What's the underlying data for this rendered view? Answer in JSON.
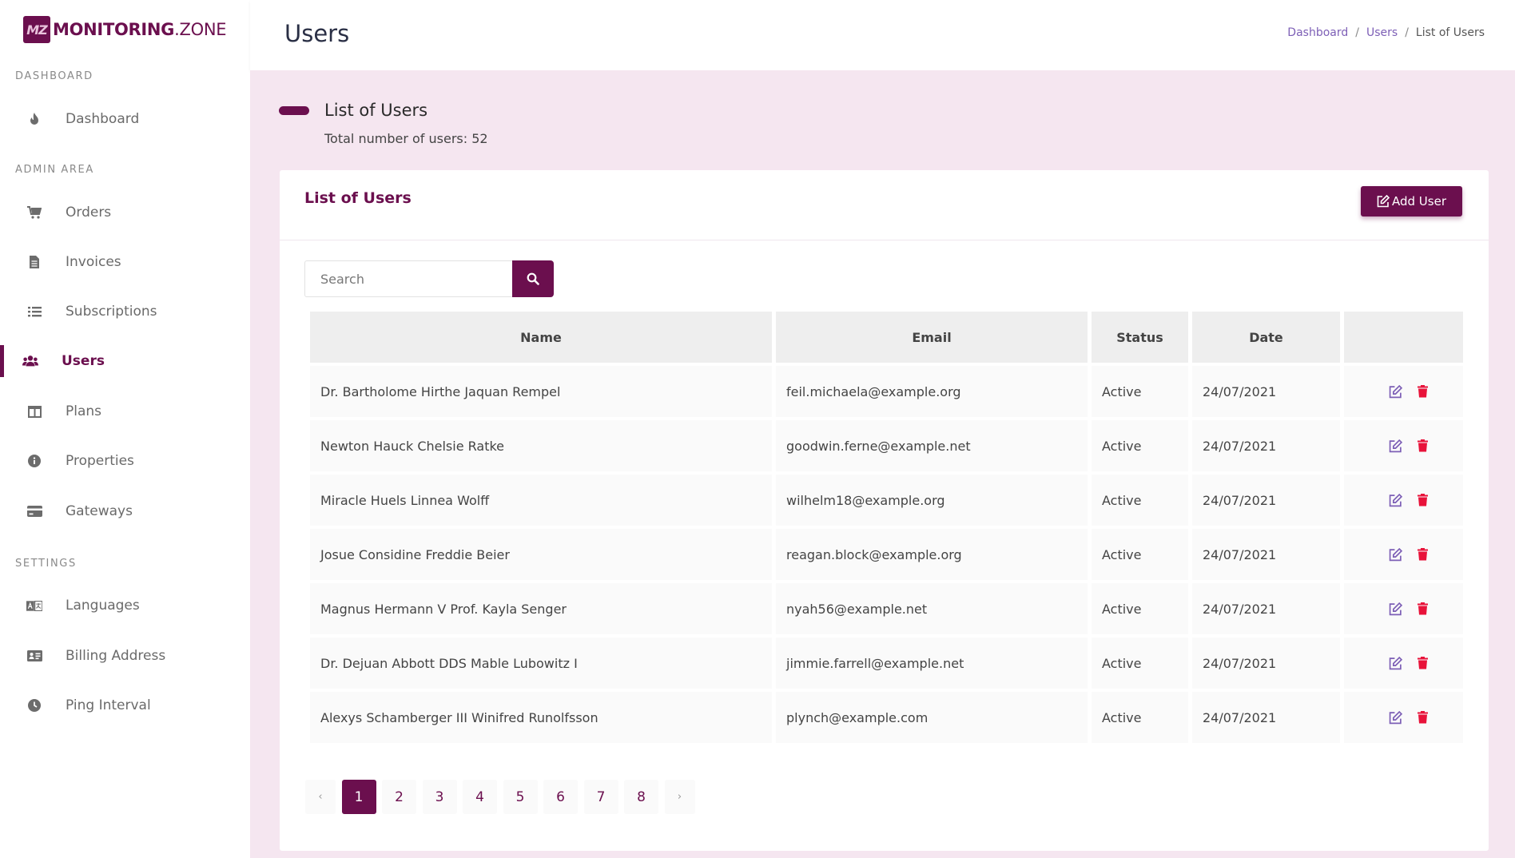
{
  "brand": {
    "badge": "MZ",
    "name_bold": "MONITORING",
    "name_light": ".ZONE"
  },
  "sidebar": {
    "sections": [
      {
        "label": "DASHBOARD"
      },
      {
        "label": "ADMIN AREA"
      },
      {
        "label": "SETTINGS"
      }
    ],
    "items": [
      {
        "label": "Dashboard",
        "icon": "fire-icon"
      },
      {
        "label": "Orders",
        "icon": "cart-icon"
      },
      {
        "label": "Invoices",
        "icon": "document-icon"
      },
      {
        "label": "Subscriptions",
        "icon": "list-icon"
      },
      {
        "label": "Users",
        "icon": "users-icon",
        "active": true
      },
      {
        "label": "Plans",
        "icon": "columns-icon"
      },
      {
        "label": "Properties",
        "icon": "info-icon"
      },
      {
        "label": "Gateways",
        "icon": "credit-card-icon"
      },
      {
        "label": "Languages",
        "icon": "language-icon"
      },
      {
        "label": "Billing Address",
        "icon": "address-card-icon"
      },
      {
        "label": "Ping Interval",
        "icon": "clock-icon"
      }
    ]
  },
  "header": {
    "title": "Users",
    "breadcrumb": [
      "Dashboard",
      "Users",
      "List of Users"
    ]
  },
  "heading": {
    "title": "List of Users",
    "subtitle": "Total number of users: 52"
  },
  "card": {
    "title": "List of Users",
    "add_label": "Add User",
    "search_placeholder": "Search"
  },
  "table": {
    "columns": [
      "Name",
      "Email",
      "Status",
      "Date",
      ""
    ],
    "rows": [
      {
        "name": "Dr. Bartholome Hirthe Jaquan Rempel",
        "email": "feil.michaela@example.org",
        "status": "Active",
        "date": "24/07/2021"
      },
      {
        "name": "Newton Hauck Chelsie Ratke",
        "email": "goodwin.ferne@example.net",
        "status": "Active",
        "date": "24/07/2021"
      },
      {
        "name": "Miracle Huels Linnea Wolff",
        "email": "wilhelm18@example.org",
        "status": "Active",
        "date": "24/07/2021"
      },
      {
        "name": "Josue Considine Freddie Beier",
        "email": "reagan.block@example.org",
        "status": "Active",
        "date": "24/07/2021"
      },
      {
        "name": "Magnus Hermann V Prof. Kayla Senger",
        "email": "nyah56@example.net",
        "status": "Active",
        "date": "24/07/2021"
      },
      {
        "name": "Dr. Dejuan Abbott DDS Mable Lubowitz I",
        "email": "jimmie.farrell@example.net",
        "status": "Active",
        "date": "24/07/2021"
      },
      {
        "name": "Alexys Schamberger III Winifred Runolfsson",
        "email": "plynch@example.com",
        "status": "Active",
        "date": "24/07/2021"
      }
    ]
  },
  "pagination": {
    "prev": "‹",
    "next": "›",
    "pages": [
      "1",
      "2",
      "3",
      "4",
      "5",
      "6",
      "7",
      "8"
    ],
    "current": "1"
  },
  "colors": {
    "brand": "#6b0f4e",
    "background": "#f5e6f0",
    "delete": "#e8133a",
    "edit": "#7d5fb6"
  }
}
